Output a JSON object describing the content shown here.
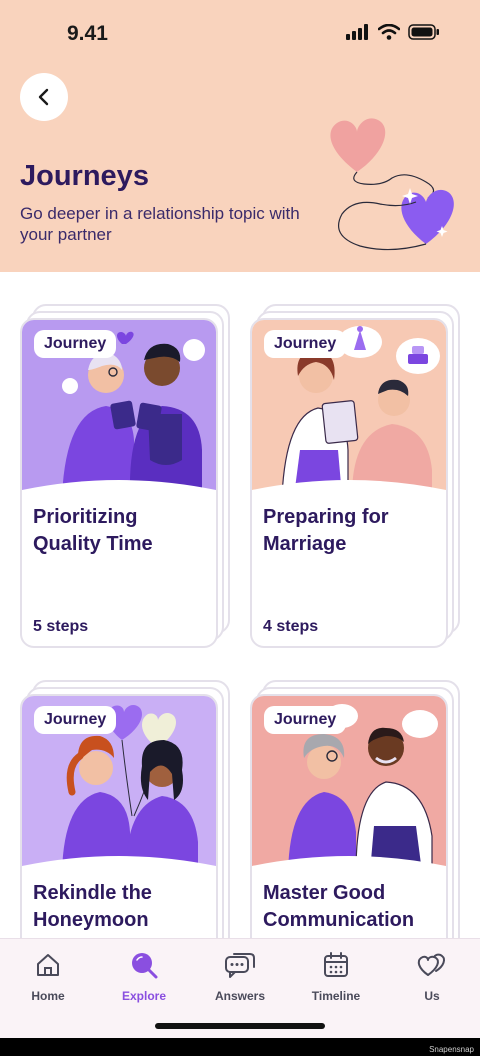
{
  "status": {
    "time": "9.41"
  },
  "header": {
    "title": "Journeys",
    "subtitle": "Go deeper in a relationship topic with your partner"
  },
  "cards": [
    {
      "badge": "Journey",
      "title": "Prioritizing Quality Time",
      "steps": "5 steps",
      "art_bg": "#b89af0"
    },
    {
      "badge": "Journey",
      "title": "Preparing for Marriage",
      "steps": "4 steps",
      "art_bg": "#f7c9b4"
    },
    {
      "badge": "Journey",
      "title": "Rekindle the Honeymoon Phase",
      "steps": "",
      "art_bg": "#c9aff5"
    },
    {
      "badge": "Journey",
      "title": "Master Good Communication",
      "steps": "",
      "art_bg": "#f0a9a3"
    }
  ],
  "tabs": [
    {
      "label": "Home",
      "icon": "home-icon"
    },
    {
      "label": "Explore",
      "icon": "explore-icon",
      "active": true
    },
    {
      "label": "Answers",
      "icon": "answers-icon"
    },
    {
      "label": "Timeline",
      "icon": "calendar-icon"
    },
    {
      "label": "Us",
      "icon": "hearts-icon"
    }
  ],
  "watermark": "Snapensnap",
  "colors": {
    "header_bg": "#f9d3bd",
    "title": "#2d1a5e",
    "accent": "#8a4fe0"
  }
}
